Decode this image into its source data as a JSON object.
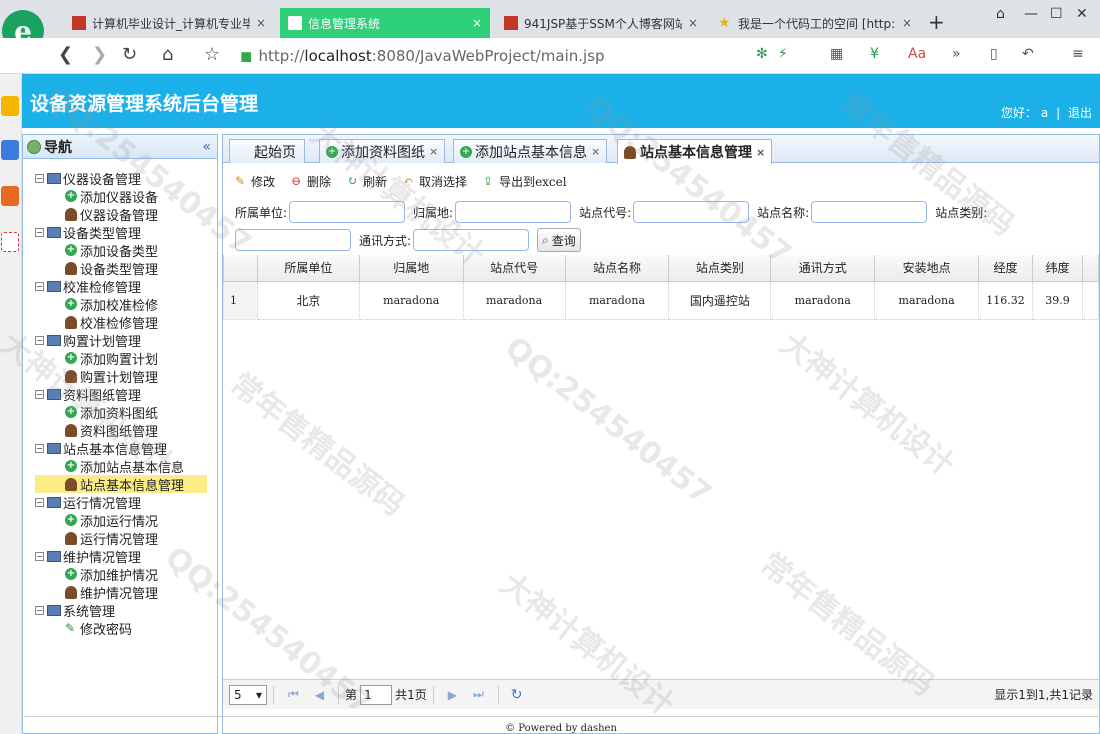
{
  "browser": {
    "tabs": [
      {
        "title": "计算机毕业设计_计算机专业毕",
        "close": "×"
      },
      {
        "title": "信息管理系统",
        "close": "×"
      },
      {
        "title": "941JSP基于SSM个人博客网站",
        "close": "×"
      },
      {
        "title": "我是一个代码工的空间 [http:",
        "close": "×"
      }
    ],
    "new_tab": "+",
    "url_prefix": "http://",
    "url_host": "localhost",
    "url_rest": ":8080/JavaWebProject/main.jsp"
  },
  "app": {
    "title": "设备资源管理系统后台管理",
    "greeting": "您好：",
    "username": "a",
    "divider": "|",
    "logout": "退出"
  },
  "sidebar": {
    "title": "导航",
    "groups": [
      {
        "label": "仪器设备管理",
        "items": [
          "添加仪器设备",
          "仪器设备管理"
        ]
      },
      {
        "label": "设备类型管理",
        "items": [
          "添加设备类型",
          "设备类型管理"
        ]
      },
      {
        "label": "校准检修管理",
        "items": [
          "添加校准检修",
          "校准检修管理"
        ]
      },
      {
        "label": "购置计划管理",
        "items": [
          "添加购置计划",
          "购置计划管理"
        ]
      },
      {
        "label": "资料图纸管理",
        "items": [
          "添加资料图纸",
          "资料图纸管理"
        ]
      },
      {
        "label": "站点基本信息管理",
        "items": [
          "添加站点基本信息",
          "站点基本信息管理"
        ]
      },
      {
        "label": "运行情况管理",
        "items": [
          "添加运行情况",
          "运行情况管理"
        ]
      },
      {
        "label": "维护情况管理",
        "items": [
          "添加维护情况",
          "维护情况管理"
        ]
      },
      {
        "label": "系统管理",
        "items": [
          "修改密码"
        ]
      }
    ],
    "selected": "站点基本信息管理"
  },
  "tabs": [
    {
      "label": "起始页",
      "closable": false
    },
    {
      "label": "添加资料图纸",
      "closable": true
    },
    {
      "label": "添加站点基本信息",
      "closable": true
    },
    {
      "label": "站点基本信息管理",
      "closable": true,
      "active": true
    }
  ],
  "toolbar": {
    "edit": "修改",
    "delete": "删除",
    "refresh": "刷新",
    "unselect": "取消选择",
    "export": "导出到excel"
  },
  "query": {
    "unit": "所属单位:",
    "belong": "归属地:",
    "code": "站点代号:",
    "name": "站点名称:",
    "type": "站点类别:",
    "comm": "通讯方式:",
    "search": "查询"
  },
  "grid": {
    "columns": [
      "所属单位",
      "归属地",
      "站点代号",
      "站点名称",
      "站点类别",
      "通讯方式",
      "安装地点",
      "经度",
      "纬度"
    ],
    "rows": [
      {
        "num": "1",
        "cells": [
          "北京",
          "maradona",
          "maradona",
          "maradona",
          "国内遥控站",
          "maradona",
          "maradona",
          "116.32",
          "39.9"
        ]
      }
    ]
  },
  "pager": {
    "page_size": "5",
    "page_label": "第",
    "page_value": "1",
    "total_pages": "共1页",
    "info": "显示1到1,共1记录"
  },
  "footer": "© Powered by dashen",
  "watermarks": [
    "大神计算机设计",
    "QQ:254540457",
    "常年售精品源码"
  ],
  "colors": {
    "banner": "#1cb0e8",
    "active_browser_tab": "#2fd07a",
    "selected_node": "#fbec88"
  }
}
